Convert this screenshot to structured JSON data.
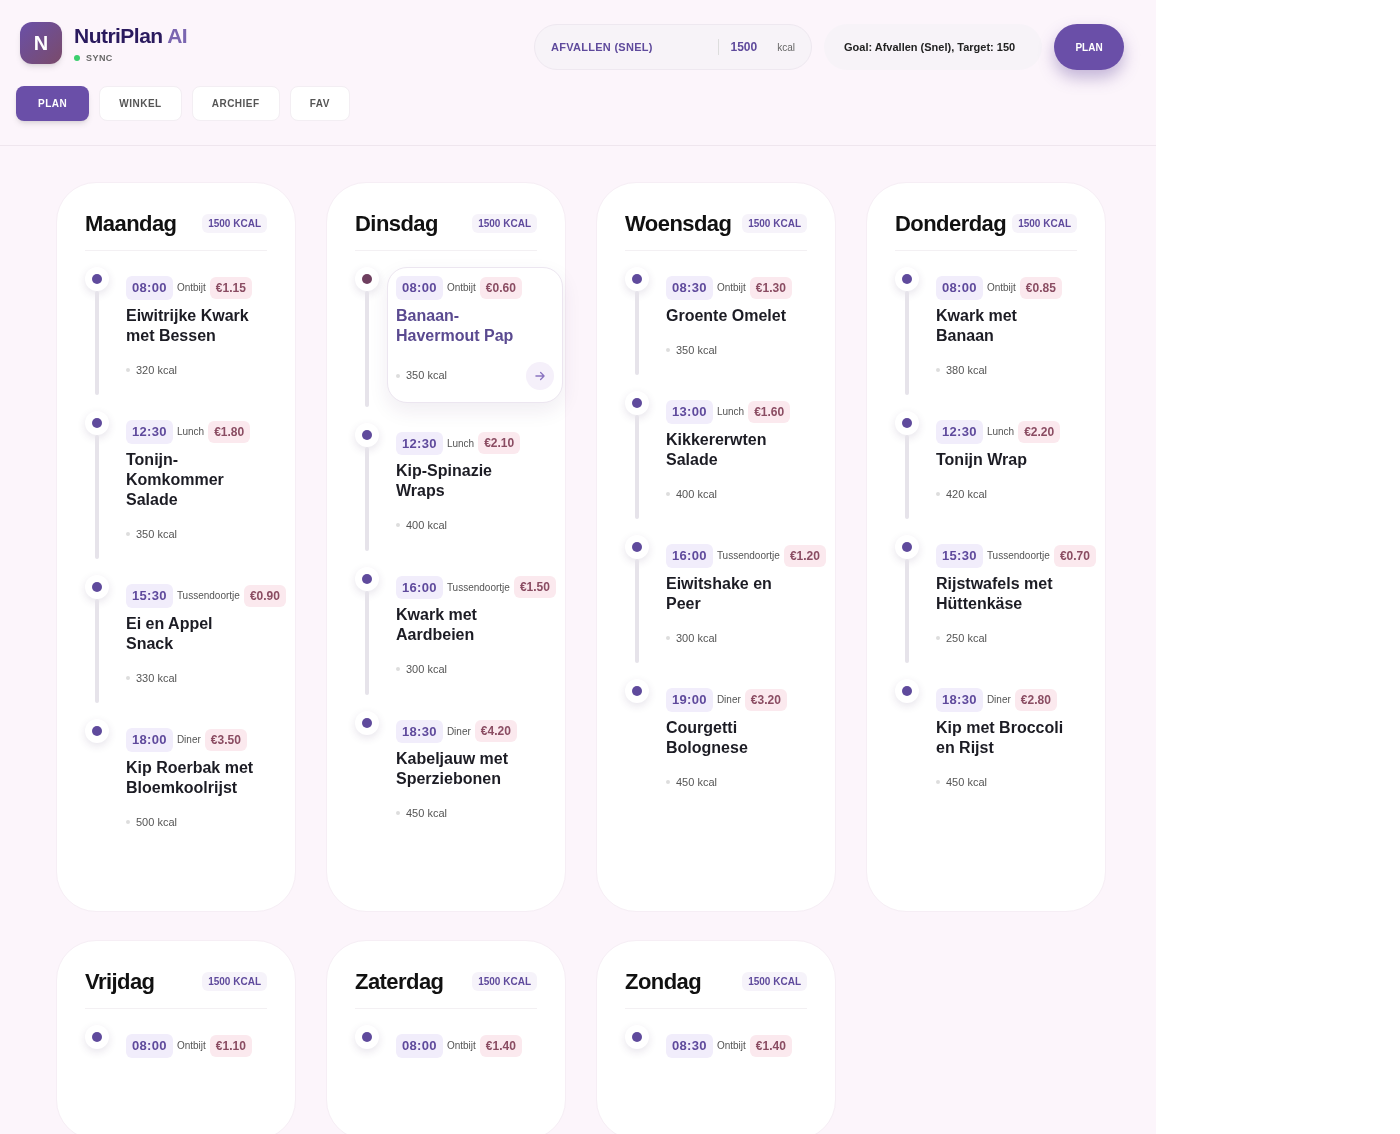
{
  "app": {
    "logo_letter": "N",
    "name": "NutriPlan",
    "name_suffix": "AI",
    "status": "SYNC"
  },
  "tabs": [
    {
      "label": "PLAN",
      "selected": true
    },
    {
      "label": "WINKEL",
      "selected": false
    },
    {
      "label": "ARCHIEF",
      "selected": false
    },
    {
      "label": "FAV",
      "selected": false
    }
  ],
  "goal_selector": {
    "goal": "AFVALLEN (SNEL)",
    "calories": "1500",
    "unit": "kcal"
  },
  "prompt_field": {
    "value": "Goal: Afvallen (Snel), Target: 150"
  },
  "plan_button": "PLAN",
  "days": [
    {
      "name": "Maandag",
      "badge": "1500 KCAL",
      "meals": [
        {
          "time": "08:00",
          "type": "Ontbijt",
          "price": "€1.15",
          "title": "Eiwitrijke Kwark met Bessen",
          "kcal": "320 kcal",
          "selected": false
        },
        {
          "time": "12:30",
          "type": "Lunch",
          "price": "€1.80",
          "title": "Tonijn-Komkommer Salade",
          "kcal": "350 kcal",
          "selected": false
        },
        {
          "time": "15:30",
          "type": "Tussendoortje",
          "price": "€0.90",
          "title": "Ei en Appel Snack",
          "kcal": "330 kcal",
          "selected": false
        },
        {
          "time": "18:00",
          "type": "Diner",
          "price": "€3.50",
          "title": "Kip Roerbak met Bloemkoolrijst",
          "kcal": "500 kcal",
          "selected": false
        }
      ]
    },
    {
      "name": "Dinsdag",
      "badge": "1500 KCAL",
      "meals": [
        {
          "time": "08:00",
          "type": "Ontbijt",
          "price": "€0.60",
          "title": "Banaan-Havermout Pap",
          "kcal": "350 kcal",
          "selected": true
        },
        {
          "time": "12:30",
          "type": "Lunch",
          "price": "€2.10",
          "title": "Kip-Spinazie Wraps",
          "kcal": "400 kcal",
          "selected": false
        },
        {
          "time": "16:00",
          "type": "Tussendoortje",
          "price": "€1.50",
          "title": "Kwark met Aardbeien",
          "kcal": "300 kcal",
          "selected": false
        },
        {
          "time": "18:30",
          "type": "Diner",
          "price": "€4.20",
          "title": "Kabeljauw met Sperziebonen",
          "kcal": "450 kcal",
          "selected": false
        }
      ]
    },
    {
      "name": "Woensdag",
      "badge": "1500 KCAL",
      "meals": [
        {
          "time": "08:30",
          "type": "Ontbijt",
          "price": "€1.30",
          "title": "Groente Omelet",
          "kcal": "350 kcal",
          "selected": false
        },
        {
          "time": "13:00",
          "type": "Lunch",
          "price": "€1.60",
          "title": "Kikkererwten Salade",
          "kcal": "400 kcal",
          "selected": false
        },
        {
          "time": "16:00",
          "type": "Tussendoortje",
          "price": "€1.20",
          "title": "Eiwitshake en Peer",
          "kcal": "300 kcal",
          "selected": false
        },
        {
          "time": "19:00",
          "type": "Diner",
          "price": "€3.20",
          "title": "Courgetti Bolognese",
          "kcal": "450 kcal",
          "selected": false
        }
      ]
    },
    {
      "name": "Donderdag",
      "badge": "1500 KCAL",
      "meals": [
        {
          "time": "08:00",
          "type": "Ontbijt",
          "price": "€0.85",
          "title": "Kwark met Banaan",
          "kcal": "380 kcal",
          "selected": false
        },
        {
          "time": "12:30",
          "type": "Lunch",
          "price": "€2.20",
          "title": "Tonijn Wrap",
          "kcal": "420 kcal",
          "selected": false
        },
        {
          "time": "15:30",
          "type": "Tussendoortje",
          "price": "€0.70",
          "title": "Rijstwafels met Hüttenkäse",
          "kcal": "250 kcal",
          "selected": false
        },
        {
          "time": "18:30",
          "type": "Diner",
          "price": "€2.80",
          "title": "Kip met Broccoli en Rijst",
          "kcal": "450 kcal",
          "selected": false
        }
      ]
    },
    {
      "name": "Vrijdag",
      "badge": "1500 KCAL",
      "meals": [
        {
          "time": "08:00",
          "type": "Ontbijt",
          "price": "€1.10",
          "selected": false
        }
      ]
    },
    {
      "name": "Zaterdag",
      "badge": "1500 KCAL",
      "meals": [
        {
          "time": "08:00",
          "type": "Ontbijt",
          "price": "€1.40",
          "selected": false
        }
      ]
    },
    {
      "name": "Zondag",
      "badge": "1500 KCAL",
      "meals": [
        {
          "time": "08:30",
          "type": "Ontbijt",
          "price": "€1.40",
          "selected": false
        }
      ]
    }
  ]
}
